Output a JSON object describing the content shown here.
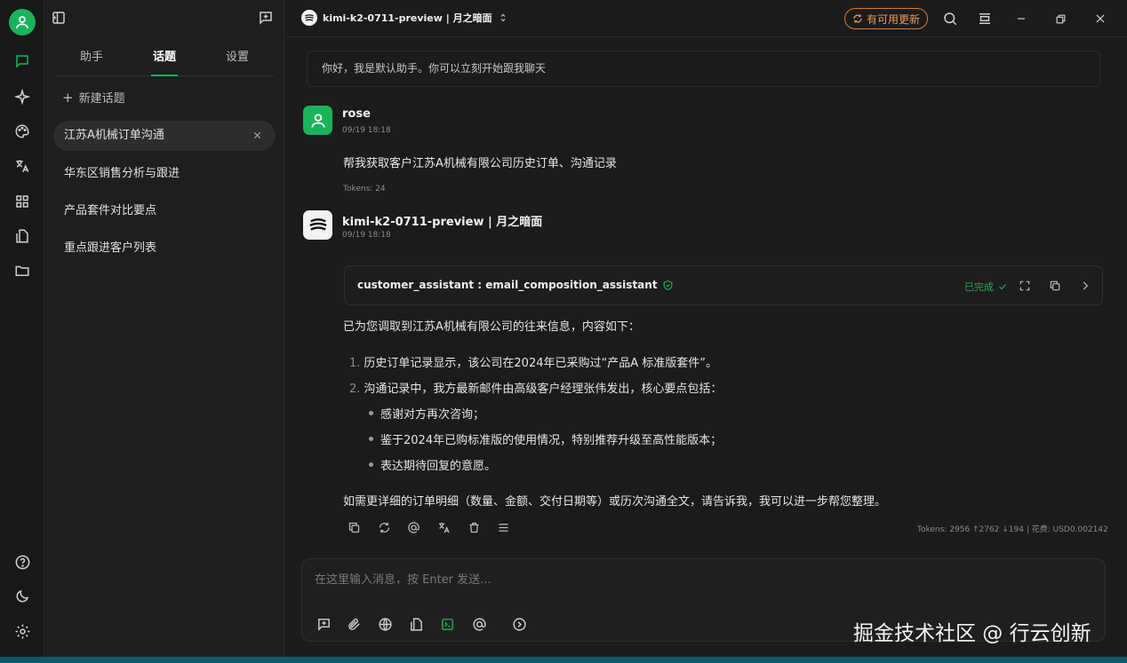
{
  "header": {
    "model_title": "kimi-k2-0711-preview | 月之暗面",
    "update_label": "有可用更新",
    "accent": "#19b45a",
    "update_color": "#e07b2a"
  },
  "sidebar": {
    "tabs": [
      {
        "label": "助手",
        "active": false
      },
      {
        "label": "话题",
        "active": true
      },
      {
        "label": "设置",
        "active": false
      }
    ],
    "new_topic": "新建话题",
    "topics": [
      {
        "label": "江苏A机械订单沟通",
        "active": true
      },
      {
        "label": "华东区销售分析与跟进",
        "active": false
      },
      {
        "label": "产品套件对比要点",
        "active": false
      },
      {
        "label": "重点跟进客户列表",
        "active": false
      }
    ]
  },
  "rail_icons": [
    "chat-icon",
    "sparkle-icon",
    "palette-icon",
    "translate-icon",
    "apps-icon",
    "document-icon",
    "folder-icon",
    "help-icon",
    "moon-icon",
    "gear-icon"
  ],
  "chat": {
    "welcome": "你好，我是默认助手。你可以立刻开始跟我聊天",
    "user": {
      "name": "rose",
      "time": "09/19 18:18",
      "text": "帮我获取客户江苏A机械有限公司历史订单、沟通记录",
      "tokens": "Tokens: 24"
    },
    "assistant": {
      "name": "kimi-k2-0711-preview | 月之暗面",
      "time": "09/19 18:18",
      "tool_name": "customer_assistant : email_composition_assistant",
      "tool_status": "已完成",
      "intro": "已为您调取到江苏A机械有限公司的往来信息，内容如下：",
      "items": [
        {
          "num": "1.",
          "text": "历史订单记录显示，该公司在2024年已采购过“产品A 标准版套件”。"
        },
        {
          "num": "2.",
          "text": "沟通记录中，我方最新邮件由高级客户经理张伟发出，核心要点包括："
        }
      ],
      "bullets": [
        "感谢对方再次咨询；",
        "鉴于2024年已购标准版的使用情况，特别推荐升级至高性能版本；",
        "表达期待回复的意愿。"
      ],
      "outro": "如需更详细的订单明细（数量、金额、交付日期等）或历次沟通全文，请告诉我，我可以进一步帮您整理。",
      "tokens": "Tokens: 2956 ↑2762 ↓194 | 花费: USD0.002142"
    }
  },
  "composer": {
    "placeholder": "在这里输入消息，按 Enter 发送..."
  },
  "watermark": "掘金技术社区 @ 行云创新"
}
